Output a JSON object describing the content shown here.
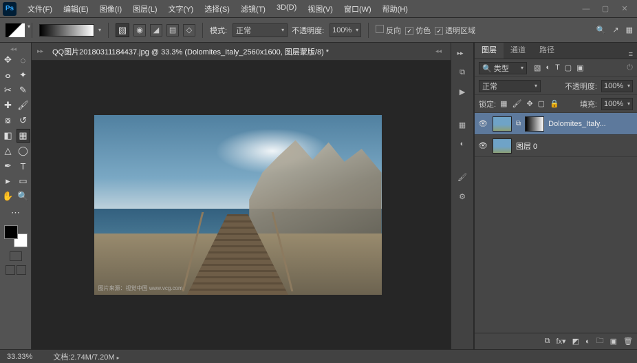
{
  "menubar": {
    "items": [
      "文件(F)",
      "编辑(E)",
      "图像(I)",
      "图层(L)",
      "文字(Y)",
      "选择(S)",
      "滤镜(T)",
      "3D(D)",
      "视图(V)",
      "窗口(W)",
      "帮助(H)"
    ]
  },
  "options": {
    "mode_label": "模式:",
    "mode_value": "正常",
    "opacity_label": "不透明度:",
    "opacity_value": "100%",
    "reverse_label": "反向",
    "dither_label": "仿色",
    "transparency_label": "透明区域",
    "reverse_checked": false,
    "dither_checked": true,
    "transparency_checked": true
  },
  "document": {
    "tab_title": "QQ图片20180311184437.jpg @ 33.3% (Dolomites_Italy_2560x1600, 图层蒙版/8) *",
    "zoom": "33.33%",
    "doc_label": "文档:",
    "doc_size": "2.74M/7.20M",
    "watermark": "图片来源：视觉中国 www.vcg.com"
  },
  "layers_panel": {
    "tabs": [
      "图层",
      "通道",
      "路径"
    ],
    "filter_label": "类型",
    "blend_mode": "正常",
    "opacity_label": "不透明度:",
    "opacity_value": "100%",
    "lock_label": "锁定:",
    "fill_label": "填充:",
    "fill_value": "100%",
    "layers": [
      {
        "name": "Dolomites_Italy...",
        "has_mask": true,
        "selected": true
      },
      {
        "name": "图层 0",
        "has_mask": false,
        "selected": false
      }
    ]
  },
  "chart_data": null
}
